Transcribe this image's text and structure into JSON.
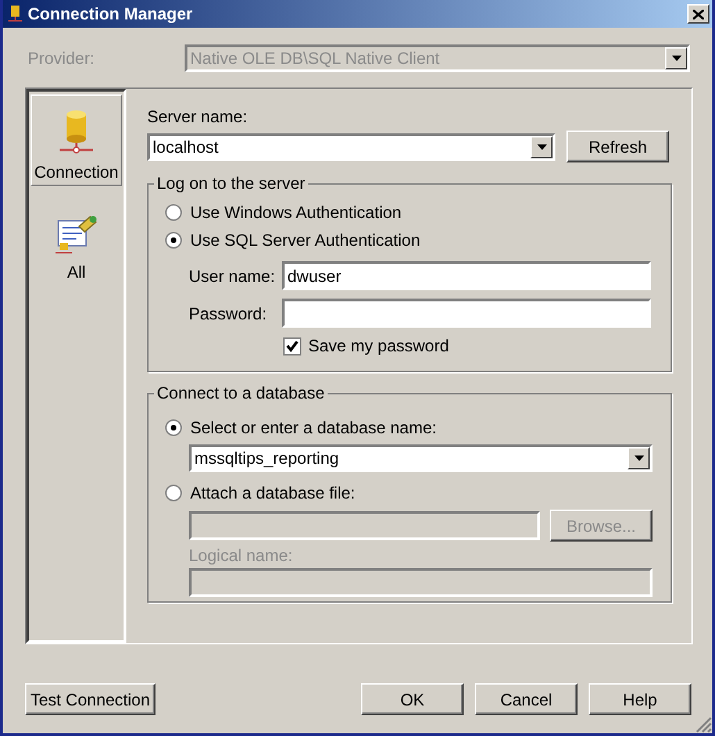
{
  "window": {
    "title": "Connection Manager"
  },
  "provider": {
    "label": "Provider:",
    "value": "Native OLE DB\\SQL Native Client",
    "disabled": true
  },
  "sidebar": {
    "items": [
      {
        "label": "Connection",
        "kind": "connection",
        "selected": true
      },
      {
        "label": "All",
        "kind": "all",
        "selected": false
      }
    ]
  },
  "server_name": {
    "label": "Server name:",
    "value": "localhost"
  },
  "refresh_button": {
    "label": "Refresh",
    "disabled": false
  },
  "logon_group": {
    "title": "Log on to the server",
    "auth_options": [
      {
        "label": "Use Windows Authentication",
        "selected": false
      },
      {
        "label": "Use SQL Server Authentication",
        "selected": true
      }
    ],
    "user_name": {
      "label": "User name:",
      "value": "dwuser"
    },
    "password": {
      "label": "Password:"
    },
    "save_password": {
      "label": "Save my password",
      "checked": true
    }
  },
  "database_group": {
    "title": "Connect to a database",
    "select_option": {
      "label": "Select or enter a database name:",
      "selected": true
    },
    "database_name": {
      "value": "mssqltips_reporting"
    },
    "attach_option": {
      "label": "Attach a database file:",
      "selected": false
    },
    "attach_file": {
      "disabled": true
    },
    "browse_button": {
      "label": "Browse...",
      "disabled": true
    },
    "logical_name": {
      "label": "Logical name:",
      "disabled": true
    }
  },
  "buttons": [
    {
      "label": "Test Connection"
    },
    {
      "label": "OK"
    },
    {
      "label": "Cancel"
    },
    {
      "label": "Help"
    }
  ]
}
